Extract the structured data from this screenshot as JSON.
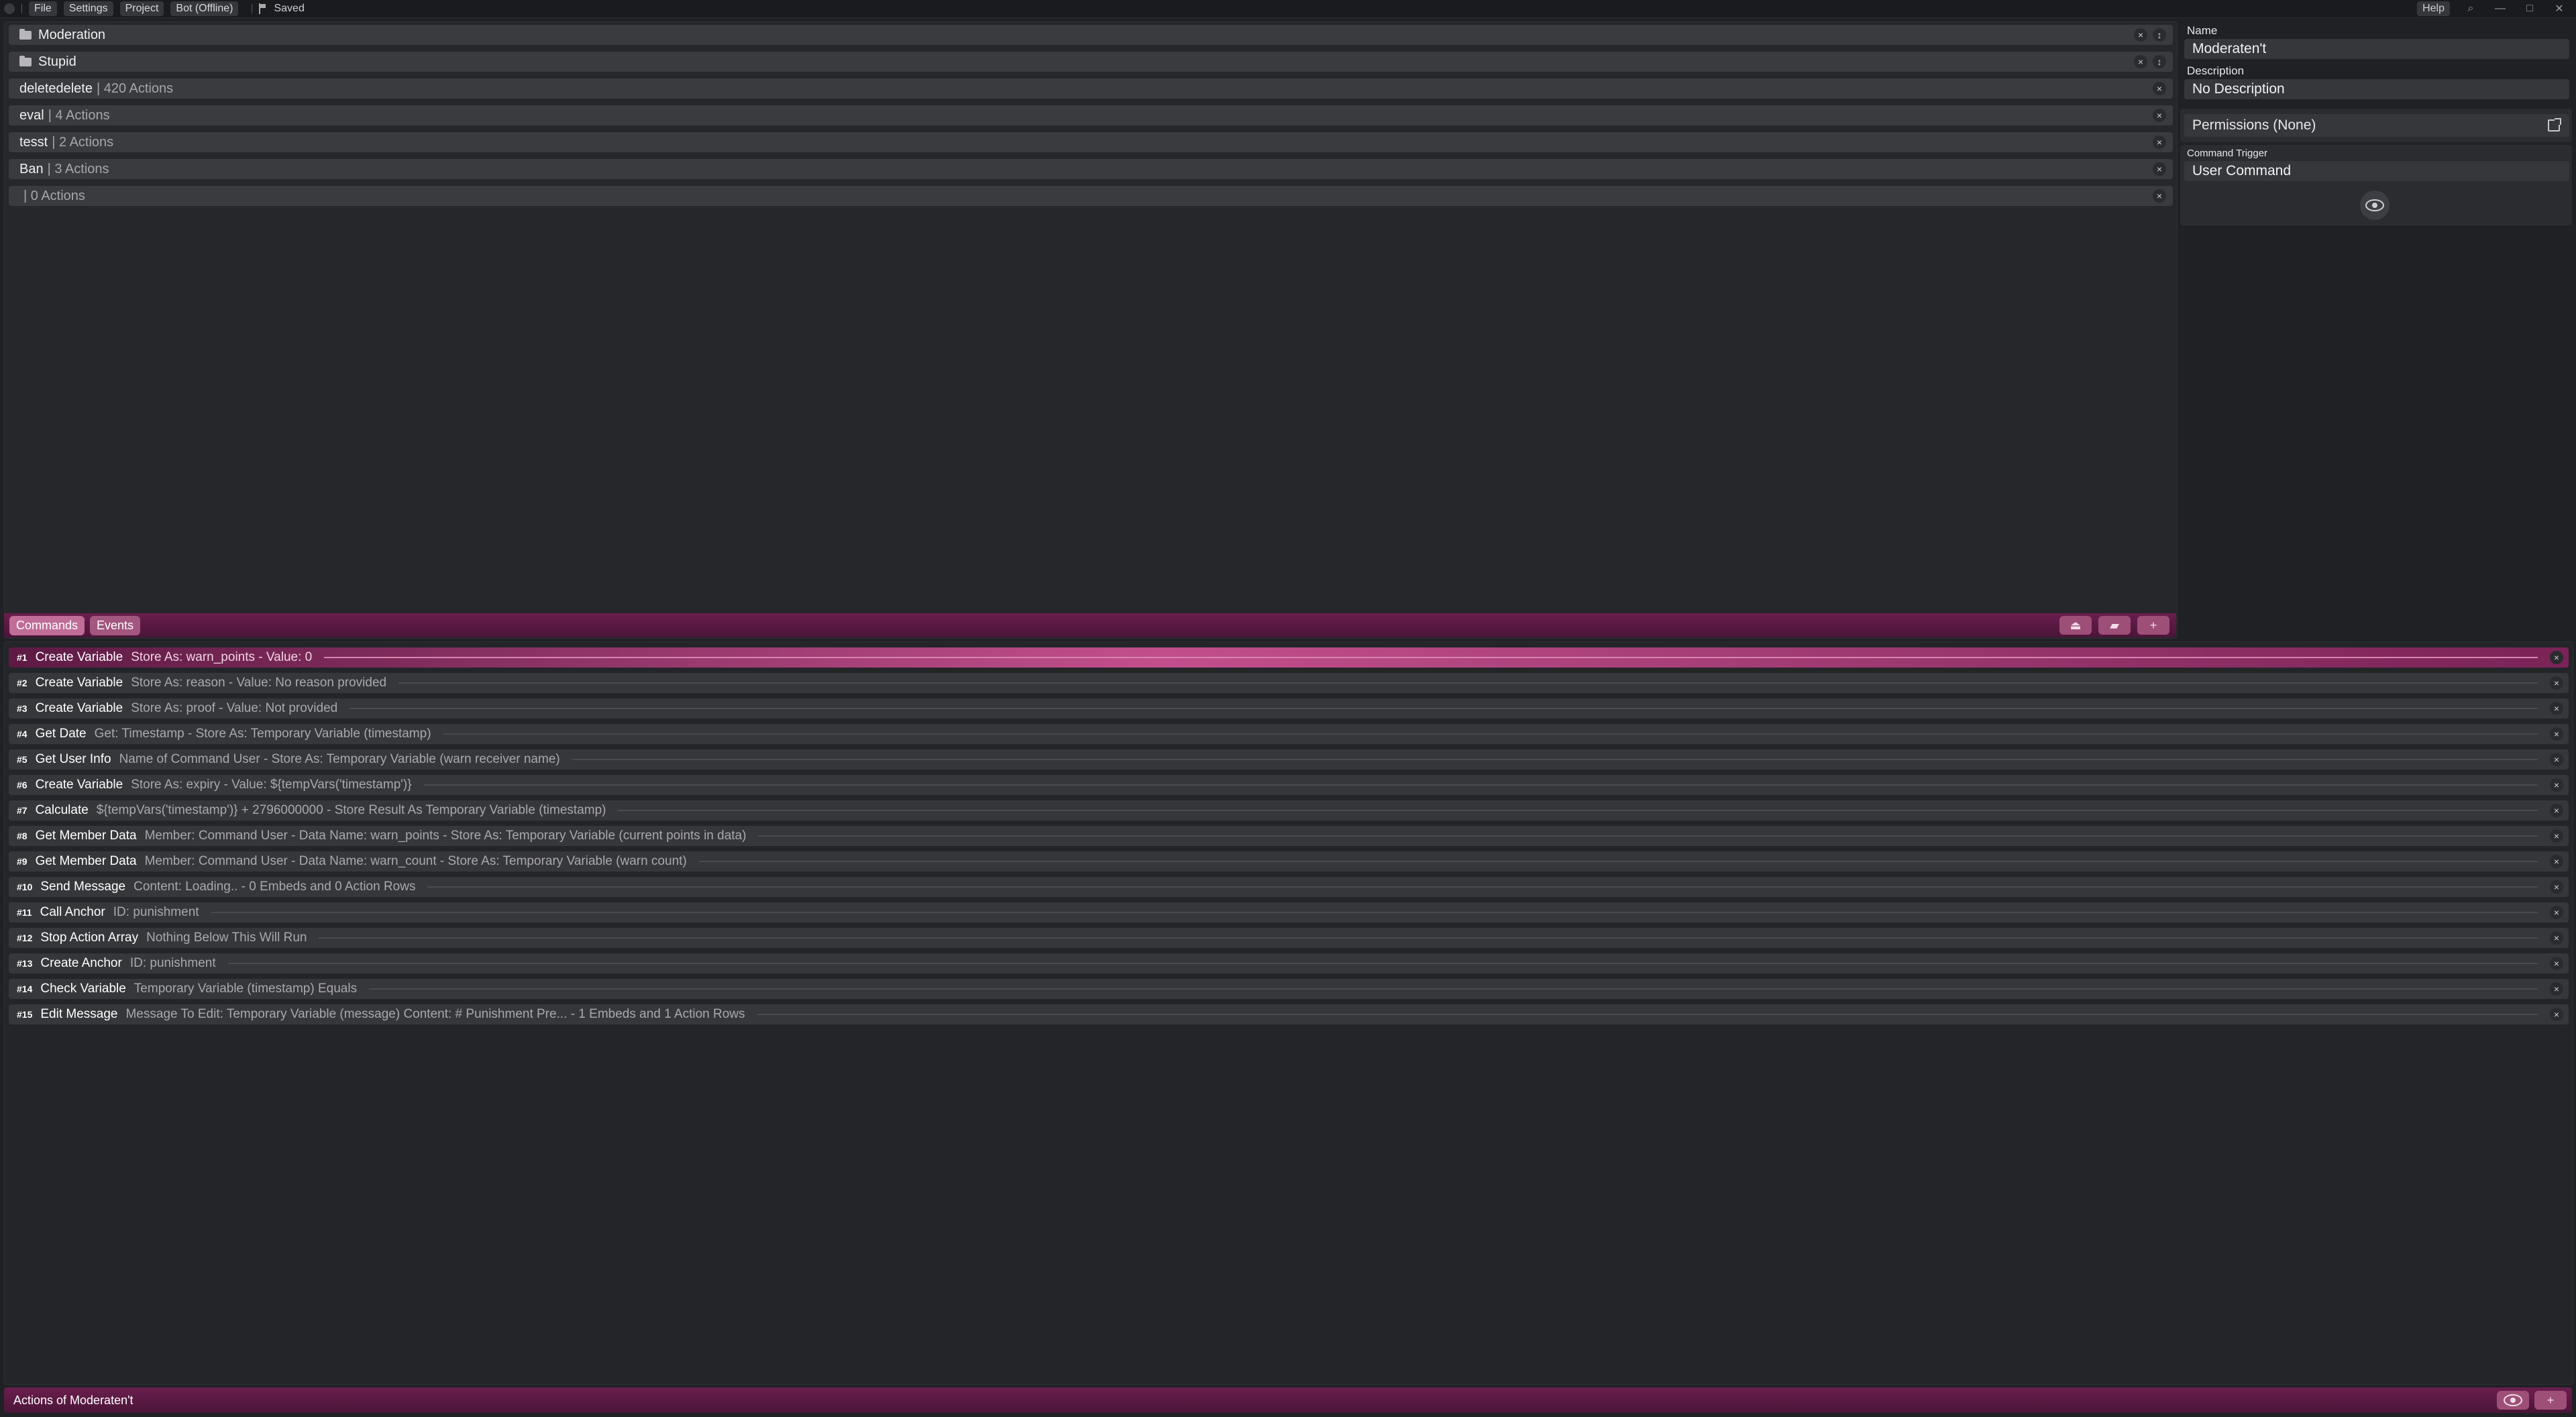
{
  "menubar": {
    "items": [
      "File",
      "Settings",
      "Project",
      "Bot (Offline)"
    ],
    "save_status": "Saved",
    "help_label": "Help"
  },
  "commands": {
    "folders": [
      {
        "name": "Moderation"
      },
      {
        "name": "Stupid"
      }
    ],
    "items": [
      {
        "name": "deletedelete",
        "meta": "| 420 Actions"
      },
      {
        "name": "eval",
        "meta": "| 4 Actions"
      },
      {
        "name": "tesst",
        "meta": "| 2 Actions"
      },
      {
        "name": "Ban",
        "meta": "| 3 Actions"
      },
      {
        "name": "",
        "meta": "| 0 Actions"
      }
    ]
  },
  "toolbar": {
    "tab_commands": "Commands",
    "tab_events": "Events"
  },
  "properties": {
    "name_label": "Name",
    "name_value": "Moderaten't",
    "description_label": "Description",
    "description_value": "No Description",
    "permissions_label": "Permissions (None)",
    "trigger_label": "Command Trigger",
    "trigger_value": "User Command"
  },
  "actions": [
    {
      "num": "#1",
      "name": "Create Variable",
      "desc": "Store As: warn_points - Value: 0",
      "selected": true
    },
    {
      "num": "#2",
      "name": "Create Variable",
      "desc": "Store As: reason - Value: No reason provided"
    },
    {
      "num": "#3",
      "name": "Create Variable",
      "desc": "Store As: proof - Value: Not provided"
    },
    {
      "num": "#4",
      "name": "Get Date",
      "desc": "Get: Timestamp - Store As: Temporary Variable (timestamp)"
    },
    {
      "num": "#5",
      "name": "Get User Info",
      "desc": "Name of Command User - Store As: Temporary Variable (warn receiver name)"
    },
    {
      "num": "#6",
      "name": "Create Variable",
      "desc": "Store As: expiry - Value: ${tempVars('timestamp')}"
    },
    {
      "num": "#7",
      "name": "Calculate",
      "desc": "${tempVars('timestamp')} + 2796000000 - Store Result As Temporary Variable (timestamp)"
    },
    {
      "num": "#8",
      "name": "Get Member Data",
      "desc": "Member: Command User - Data Name: warn_points - Store As: Temporary Variable (current points in data)"
    },
    {
      "num": "#9",
      "name": "Get Member Data",
      "desc": "Member: Command User - Data Name: warn_count - Store As: Temporary Variable (warn count)"
    },
    {
      "num": "#10",
      "name": "Send Message",
      "desc": "Content: Loading.. - 0 Embeds and 0 Action Rows"
    },
    {
      "num": "#11",
      "name": "Call Anchor",
      "desc": "ID: punishment"
    },
    {
      "num": "#12",
      "name": "Stop Action Array",
      "desc": "Nothing Below This Will Run"
    },
    {
      "num": "#13",
      "name": "Create Anchor",
      "desc": "ID: punishment"
    },
    {
      "num": "#14",
      "name": "Check Variable",
      "desc": "Temporary Variable (timestamp) Equals"
    },
    {
      "num": "#15",
      "name": "Edit Message",
      "desc": "Message To Edit: Temporary Variable (message) Content: # Punishment Pre... - 1 Embeds and 1 Action Rows"
    }
  ],
  "footer": {
    "title": "Actions of Moderaten't"
  },
  "icons": {
    "close": "×",
    "move": "↕",
    "plus": "+"
  },
  "colors": {
    "accent": "#6a1e4e",
    "accent_light": "#c24f8c",
    "background": "#202125",
    "row": "#36373b"
  }
}
